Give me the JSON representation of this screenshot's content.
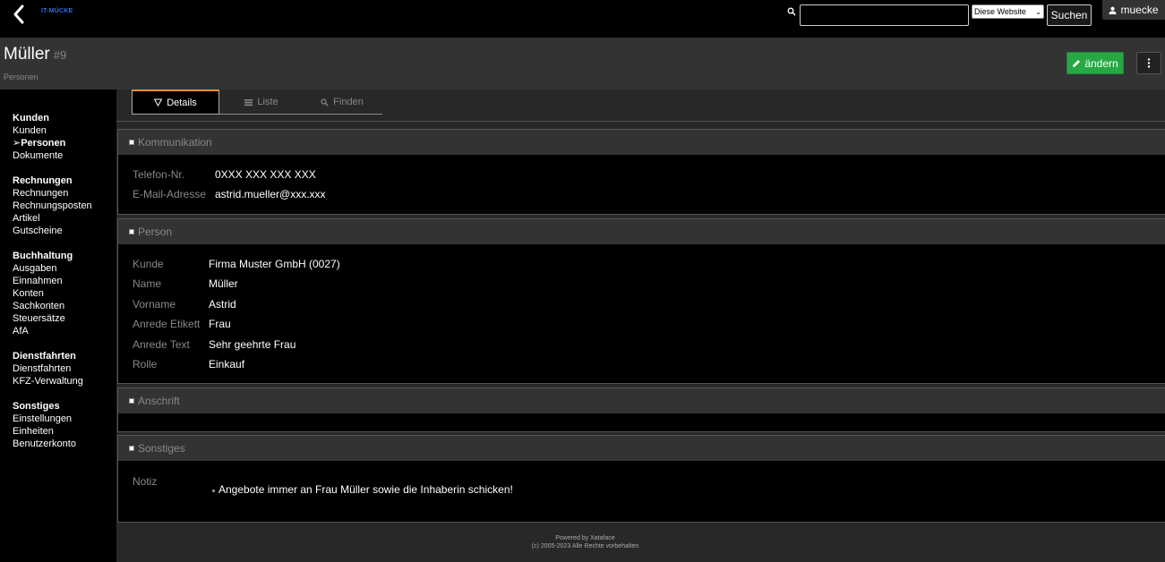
{
  "topbar": {
    "brand": "IT-MÜCKE",
    "search_value": "",
    "search_scope": "Diese Website",
    "search_button": "Suchen",
    "user": "muecke"
  },
  "record": {
    "title": "Müller",
    "id": "#9",
    "table": "Personen",
    "edit_button": "ändern"
  },
  "sidebar": {
    "groups": [
      {
        "heading": "Kunden",
        "items": [
          "Kunden",
          "Personen",
          "Dokumente"
        ]
      },
      {
        "heading": "Rechnungen",
        "items": [
          "Rechnungen",
          "Rechnungsposten",
          "Artikel",
          "Gutscheine"
        ]
      },
      {
        "heading": "Buchhaltung",
        "items": [
          "Ausgaben",
          "Einnahmen",
          "Konten",
          "Sachkonten",
          "Steuersätze",
          "AfA"
        ]
      },
      {
        "heading": "Dienstfahrten",
        "items": [
          "Dienstfahrten",
          "KFZ-Verwaltung"
        ]
      },
      {
        "heading": "Sonstiges",
        "items": [
          "Einstellungen",
          "Einheiten",
          "Benutzerkonto"
        ]
      }
    ],
    "active_marker": "➢"
  },
  "tabs": [
    "Details",
    "Liste",
    "Finden"
  ],
  "sections": {
    "kommunikation": {
      "title": "Kommunikation",
      "fields": [
        {
          "label": "Telefon-Nr.",
          "value": "0XXX XXX XXX XXX"
        },
        {
          "label": "E-Mail-Adresse",
          "value": "astrid.mueller@xxx.xxx"
        }
      ]
    },
    "person": {
      "title": "Person",
      "fields": [
        {
          "label": "Kunde",
          "value": "Firma Muster GmbH (0027)"
        },
        {
          "label": "Name",
          "value": "Müller"
        },
        {
          "label": "Vorname",
          "value": "Astrid"
        },
        {
          "label": "Anrede Etikett",
          "value": "Frau"
        },
        {
          "label": "Anrede Text",
          "value": "Sehr geehrte Frau"
        },
        {
          "label": "Rolle",
          "value": "Einkauf"
        }
      ]
    },
    "anschrift": {
      "title": "Anschrift"
    },
    "sonstiges": {
      "title": "Sonstiges",
      "fields": [
        {
          "label": "Notiz",
          "value": "Angebote immer an Frau Müller sowie die Inhaberin schicken!"
        }
      ]
    }
  },
  "footer": {
    "line1": "Powered by Xataface",
    "line2": "(c) 2005-2023 Alle Rechte vorbehalten"
  },
  "colors": {
    "accent_green": "#28a745",
    "brand_blue": "#2d6ee8",
    "tab_active_border": "#e8912c"
  }
}
